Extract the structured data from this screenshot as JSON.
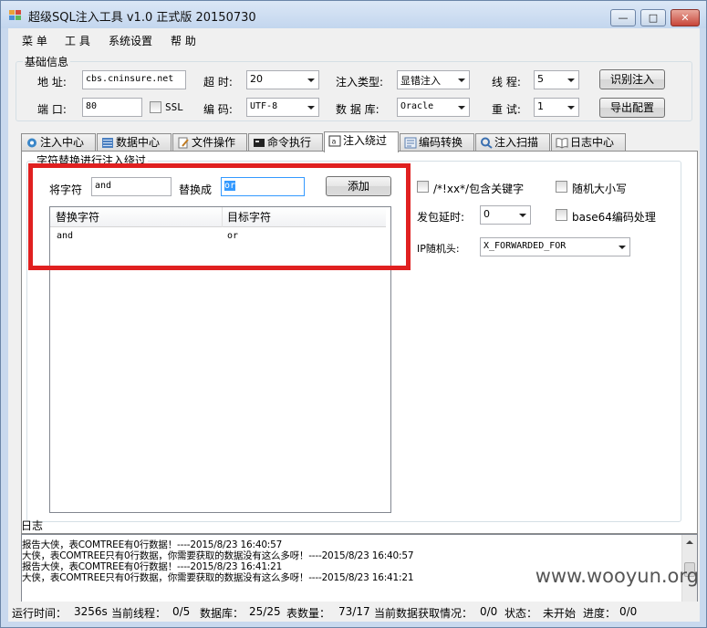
{
  "window": {
    "title": "超级SQL注入工具 v1.0 正式版 20150730",
    "min_glyph": "—",
    "max_glyph": "□",
    "close_glyph": "✕"
  },
  "menu": [
    "菜 单",
    "工 具",
    "系统设置",
    "帮 助"
  ],
  "basic": {
    "group_title": "基础信息",
    "address_label": "地 址:",
    "address_value": "cbs.cninsure.net",
    "port_label": "端 口:",
    "port_value": "80",
    "ssl_label": "SSL",
    "timeout_label": "超 时:",
    "timeout_value": "20",
    "encoding_label": "编 码:",
    "encoding_value": "UTF-8",
    "inject_type_label": "注入类型:",
    "inject_type_value": "显错注入",
    "database_label": "数 据 库:",
    "database_value": "Oracle",
    "threads_label": "线 程:",
    "threads_value": "5",
    "retry_label": "重 试:",
    "retry_value": "1",
    "identify_button": "识别注入",
    "export_button": "导出配置"
  },
  "tabs": [
    {
      "label": "注入中心",
      "icon": "gear-icon"
    },
    {
      "label": "数据中心",
      "icon": "database-icon"
    },
    {
      "label": "文件操作",
      "icon": "file-edit-icon"
    },
    {
      "label": "命令执行",
      "icon": "terminal-icon"
    },
    {
      "label": "注入绕过",
      "icon": "bypass-icon",
      "active": true
    },
    {
      "label": "编码转换",
      "icon": "encode-icon"
    },
    {
      "label": "注入扫描",
      "icon": "scan-icon"
    },
    {
      "label": "日志中心",
      "icon": "book-icon"
    }
  ],
  "bypass": {
    "group_title": "字符替换进行注入绕过",
    "from_label": "将字符",
    "from_value": "and",
    "to_label": "替换成",
    "to_value": "or",
    "add_button": "添加",
    "table_headers": [
      "替换字符",
      "目标字符"
    ],
    "table_rows": [
      [
        "and",
        "or"
      ]
    ],
    "comment_option": "/*!xx*/包含关键字",
    "random_case_option": "随机大小写",
    "delay_label": "发包延时:",
    "delay_value": "0",
    "base64_option": "base64编码处理",
    "ip_header_label": "IP随机头:",
    "ip_header_value": "X_FORWARDED_FOR"
  },
  "log": {
    "title": "日志",
    "lines": [
      "报告大侠，表COMTREE有0行数据！----2015/8/23 16:40:57",
      "大侠，表COMTREE只有0行数据，你需要获取的数据没有这么多呀！----2015/8/23 16:40:57",
      "报告大侠，表COMTREE有0行数据！----2015/8/23 16:41:21",
      "大侠，表COMTREE只有0行数据，你需要获取的数据没有这么多呀！----2015/8/23 16:41:21"
    ]
  },
  "status": {
    "runtime_label": "运行时间：",
    "runtime_value": "3256s",
    "threads_label": "当前线程：",
    "threads_value": "0/5",
    "db_label": "数据库：",
    "db_value": "25/25",
    "tables_label": "表数量：",
    "tables_value": "73/17",
    "fetch_label": "当前数据获取情况：",
    "fetch_value": "0/0",
    "state_label": "状态：",
    "state_value": "未开始",
    "progress_label": "进度：",
    "progress_value": "0/0"
  },
  "watermark": "www.wooyun.org"
}
